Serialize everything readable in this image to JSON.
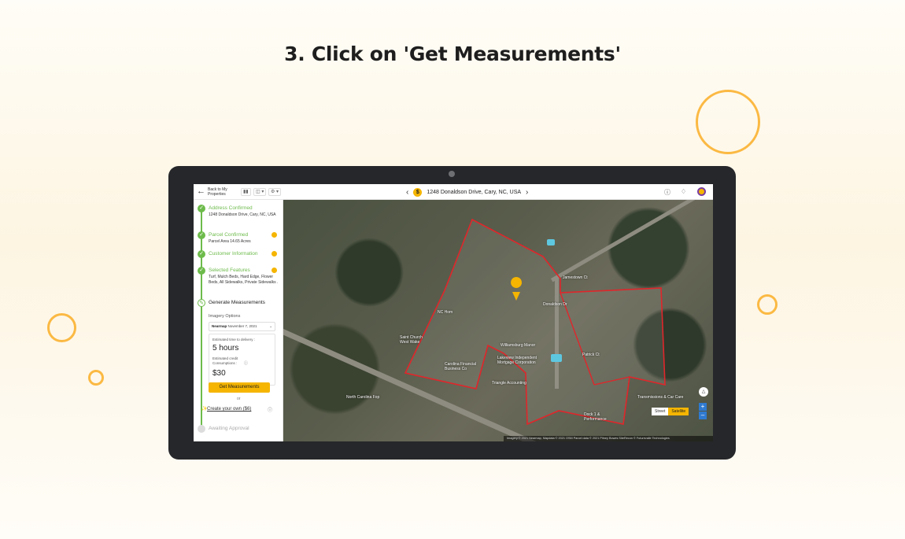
{
  "page": {
    "headline": "3. Click on 'Get Measurements'"
  },
  "colors": {
    "accent": "#f5b500",
    "success": "#6dbb4b",
    "ring": "#fbb943",
    "parcel_outline": "#e0262b"
  },
  "topbar": {
    "back_label": "Back to My Properties",
    "address": "1248 Donaldson Drive, Cary, NC, USA",
    "icons": [
      "back-arrow-icon",
      "layers-icon",
      "chevron-left-icon",
      "coin-icon",
      "chevron-right-icon",
      "help-icon",
      "bell-icon",
      "avatar"
    ]
  },
  "sidebar": {
    "steps": [
      {
        "title": "Address Confirmed",
        "subtitle": "1248 Donaldson Drive, Cary, NC, USA"
      },
      {
        "title": "Parcel Confirmed",
        "subtitle": "Parcel Area 14.65 Acres"
      },
      {
        "title": "Customer Information",
        "subtitle": ""
      },
      {
        "title": "Selected Features",
        "subtitle": "Turf, Mulch Beds, Hard Edge, Flower Beds, All Sidewalks, Private Sidewalks ."
      },
      {
        "title": "Generate Measurements",
        "subtitle": ""
      },
      {
        "title": "Awaiting Approval",
        "subtitle": ""
      }
    ],
    "imagery_label": "Imagery Options",
    "imagery_provider": "Nearmap",
    "imagery_date": "November 7, 2021",
    "estimated_time_label": "Estimated time to delivery :",
    "estimated_time_value": "5 hours",
    "credit_label": "Estimated credit Consumptions :",
    "credit_value": "$30",
    "cta_label": "Get Measurements",
    "or_label": "or",
    "create_label": "Create your own ($6)"
  },
  "map": {
    "labels": [
      "NC Hom",
      "Saint Church West Wake",
      "Williamsburg Manor",
      "Lakeview Independent Mortgage Corporation",
      "Carolina Financial Business Co",
      "Triangle Accounting",
      "North Carolina Fop",
      "Patrick Ct",
      "Jamestown Ct",
      "Donaldson Dr",
      "Dock 1 & Performance",
      "Transmissions & Car Care"
    ],
    "street_label": "Street",
    "satellite_label": "Satellite",
    "attribution": "Imagery © 2021 Nearmap, Mapdata © 2021 OSM Parcel data © 2021 Pitney Bowes   SiteRecon © Futurevalle Technologies"
  }
}
